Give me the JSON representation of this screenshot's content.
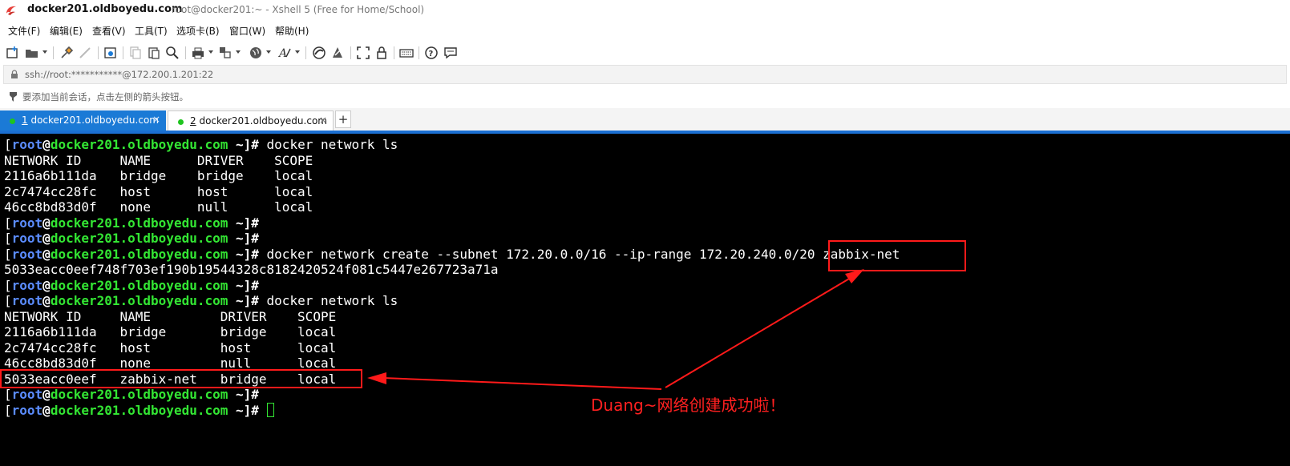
{
  "window": {
    "title_host": "docker201.oldboyedu.com",
    "title_rest": "root@docker201:~ - Xshell 5 (Free for Home/School)"
  },
  "menu": {
    "items": [
      "文件(F)",
      "编辑(E)",
      "查看(V)",
      "工具(T)",
      "选项卡(B)",
      "窗口(W)",
      "帮助(H)"
    ]
  },
  "toolbar": {
    "icons": [
      "new-session-icon",
      "open-folder-icon",
      "reconnect-icon",
      "disconnect-icon",
      "properties-icon",
      "copy-icon",
      "paste-icon",
      "find-icon",
      "print-icon",
      "transfer-icon",
      "globe-icon",
      "font-icon",
      "xftp-icon",
      "xmanager-icon",
      "fullscreen-icon",
      "lock-icon",
      "keyboard-icon",
      "help-icon",
      "chat-icon"
    ]
  },
  "address": {
    "text": "ssh://root:***********@172.200.1.201:22"
  },
  "hint": {
    "text": "要添加当前会话，点击左侧的箭头按钮。"
  },
  "tabs": [
    {
      "number": "1",
      "label": " docker201.oldboyedu.com",
      "close": "×",
      "active": true
    },
    {
      "number": "2",
      "label": " docker201.oldboyedu.com",
      "close": "×",
      "active": false
    }
  ],
  "tab_add": "+",
  "terminal": {
    "prompt": {
      "open_bracket": "[",
      "user": "root",
      "at": "@",
      "host": "docker201.oldboyedu.com",
      "tail": " ~]#"
    },
    "lines": [
      {
        "kind": "prompt",
        "cmd": " docker network ls"
      },
      {
        "kind": "out",
        "text": "NETWORK ID     NAME      DRIVER    SCOPE"
      },
      {
        "kind": "out",
        "text": "2116a6b111da   bridge    bridge    local"
      },
      {
        "kind": "out",
        "text": "2c7474cc28fc   host      host      local"
      },
      {
        "kind": "out",
        "text": "46cc8bd83d0f   none      null      local"
      },
      {
        "kind": "prompt",
        "cmd": ""
      },
      {
        "kind": "prompt",
        "cmd": ""
      },
      {
        "kind": "prompt",
        "cmd": " docker network create --subnet 172.20.0.0/16 --ip-range 172.20.240.0/20 zabbix-net"
      },
      {
        "kind": "out",
        "text": "5033eacc0eef748f703ef190b19544328c8182420524f081c5447e267723a71a"
      },
      {
        "kind": "prompt",
        "cmd": ""
      },
      {
        "kind": "prompt",
        "cmd": " docker network ls"
      },
      {
        "kind": "out",
        "text": "NETWORK ID     NAME         DRIVER    SCOPE"
      },
      {
        "kind": "out",
        "text": "2116a6b111da   bridge       bridge    local"
      },
      {
        "kind": "out",
        "text": "2c7474cc28fc   host         host      local"
      },
      {
        "kind": "out",
        "text": "46cc8bd83d0f   none         null      local"
      },
      {
        "kind": "out",
        "text": "5033eacc0eef   zabbix-net   bridge    local"
      },
      {
        "kind": "prompt",
        "cmd": ""
      },
      {
        "kind": "prompt",
        "cmd": " ",
        "cursor": true
      }
    ]
  },
  "annotation": {
    "text": "Duang~网络创建成功啦！",
    "color": "#ff2020"
  }
}
